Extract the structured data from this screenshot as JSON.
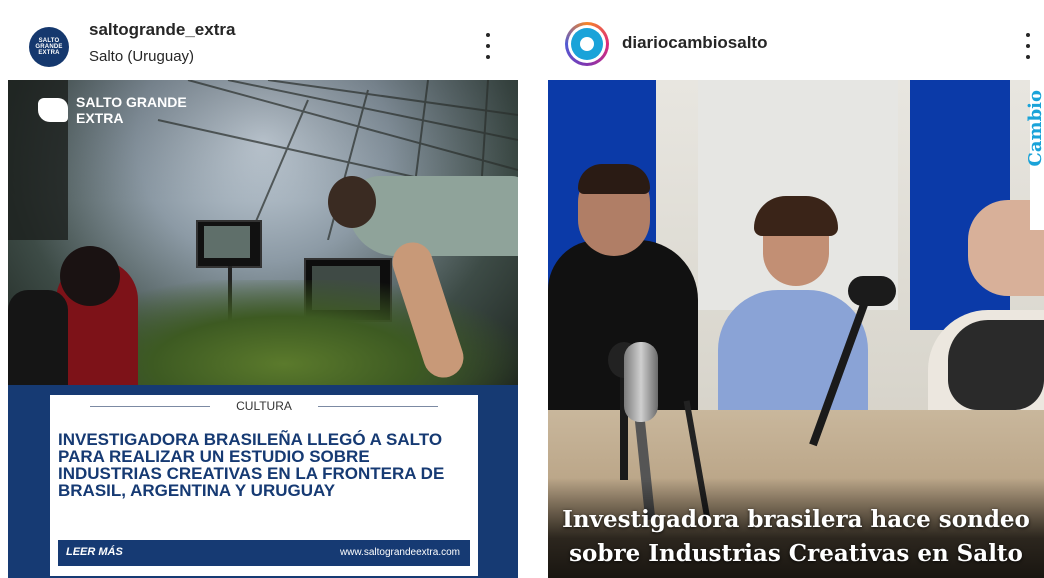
{
  "posts": [
    {
      "username": "saltogrande_extra",
      "location": "Salto (Uruguay)",
      "avatar_text": [
        "SALTO",
        "GRANDE",
        "EXTRA"
      ],
      "logo_lines": [
        "SALTO GRANDE",
        "EXTRA"
      ],
      "category": "CULTURA",
      "headline": "INVESTIGADORA BRASILEÑA LLEGÓ A SALTO PARA REALIZAR UN ESTUDIO SOBRE INDUSTRIAS CREATIVAS EN LA FRONTERA DE BRASIL, ARGENTINA Y URUGUAY",
      "read_more": "LEER MÁS",
      "website": "www.saltograndeextra.com"
    },
    {
      "username": "diariocambiosalto",
      "caption_line1": "Investigadora brasilera hace sondeo",
      "caption_line2": "sobre Industrias Creativas en Salto",
      "side_logo": "Cambio"
    }
  ],
  "colors": {
    "brand_navy": "#163a73",
    "cambio_blue": "#1aa3d9",
    "foam_blue": "#0b3aa8"
  }
}
